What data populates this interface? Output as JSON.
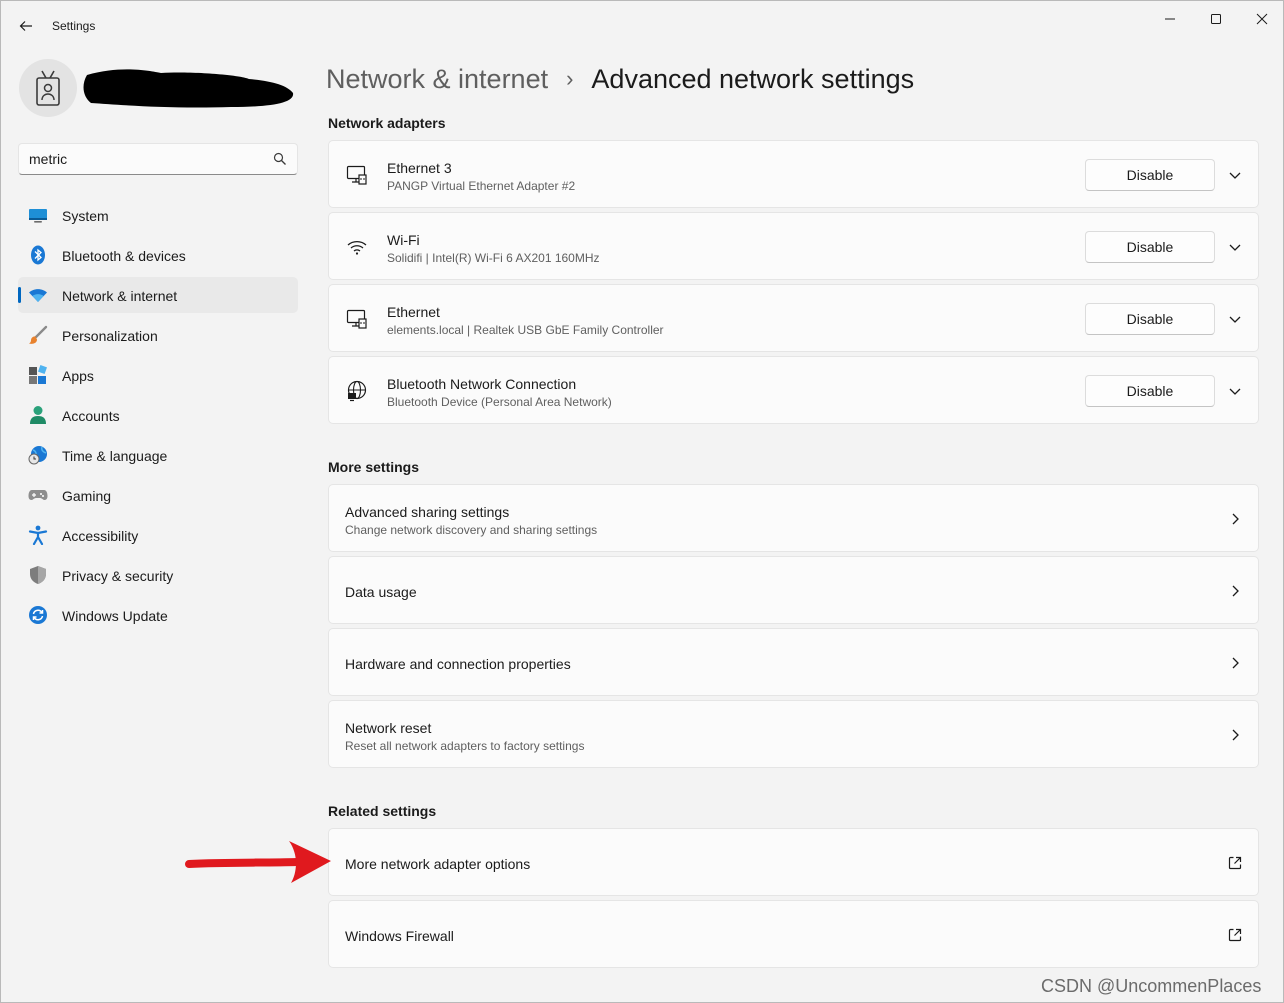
{
  "window": {
    "title": "Settings"
  },
  "search": {
    "value": "metric",
    "icon": "search-icon"
  },
  "nav": {
    "items": [
      {
        "label": "System",
        "icon": "system-icon"
      },
      {
        "label": "Bluetooth & devices",
        "icon": "bluetooth-icon"
      },
      {
        "label": "Network & internet",
        "icon": "wifi-icon",
        "active": true
      },
      {
        "label": "Personalization",
        "icon": "brush-icon"
      },
      {
        "label": "Apps",
        "icon": "apps-icon"
      },
      {
        "label": "Accounts",
        "icon": "person-icon"
      },
      {
        "label": "Time & language",
        "icon": "globe-clock-icon"
      },
      {
        "label": "Gaming",
        "icon": "gamepad-icon"
      },
      {
        "label": "Accessibility",
        "icon": "accessibility-icon"
      },
      {
        "label": "Privacy & security",
        "icon": "shield-icon"
      },
      {
        "label": "Windows Update",
        "icon": "update-icon"
      }
    ]
  },
  "breadcrumb": {
    "parent": "Network & internet",
    "separator": "›",
    "current": "Advanced network settings"
  },
  "sections": {
    "adapters_title": "Network adapters",
    "more_title": "More settings",
    "related_title": "Related settings"
  },
  "adapters": [
    {
      "name": "Ethernet 3",
      "description": "PANGP Virtual Ethernet Adapter #2",
      "button": "Disable",
      "icon": "ethernet-icon"
    },
    {
      "name": "Wi-Fi",
      "description": "Solidifi | Intel(R) Wi-Fi 6 AX201 160MHz",
      "button": "Disable",
      "icon": "wifi-icon"
    },
    {
      "name": "Ethernet",
      "description": "elements.local | Realtek USB GbE Family Controller",
      "button": "Disable",
      "icon": "ethernet-icon"
    },
    {
      "name": "Bluetooth Network Connection",
      "description": "Bluetooth Device (Personal Area Network)",
      "button": "Disable",
      "icon": "globe-network-icon"
    }
  ],
  "more_settings": [
    {
      "title": "Advanced sharing settings",
      "subtitle": "Change network discovery and sharing settings"
    },
    {
      "title": "Data usage",
      "subtitle": ""
    },
    {
      "title": "Hardware and connection properties",
      "subtitle": ""
    },
    {
      "title": "Network reset",
      "subtitle": "Reset all network adapters to factory settings"
    }
  ],
  "related_settings": [
    {
      "title": "More network adapter options"
    },
    {
      "title": "Windows Firewall"
    }
  ],
  "annotation": {
    "arrow_color": "#e0191e"
  },
  "watermark": "CSDN @UncommenPlaces",
  "colors": {
    "accent": "#0067c0",
    "background": "#f3f3f3",
    "card": "#fbfbfb"
  }
}
